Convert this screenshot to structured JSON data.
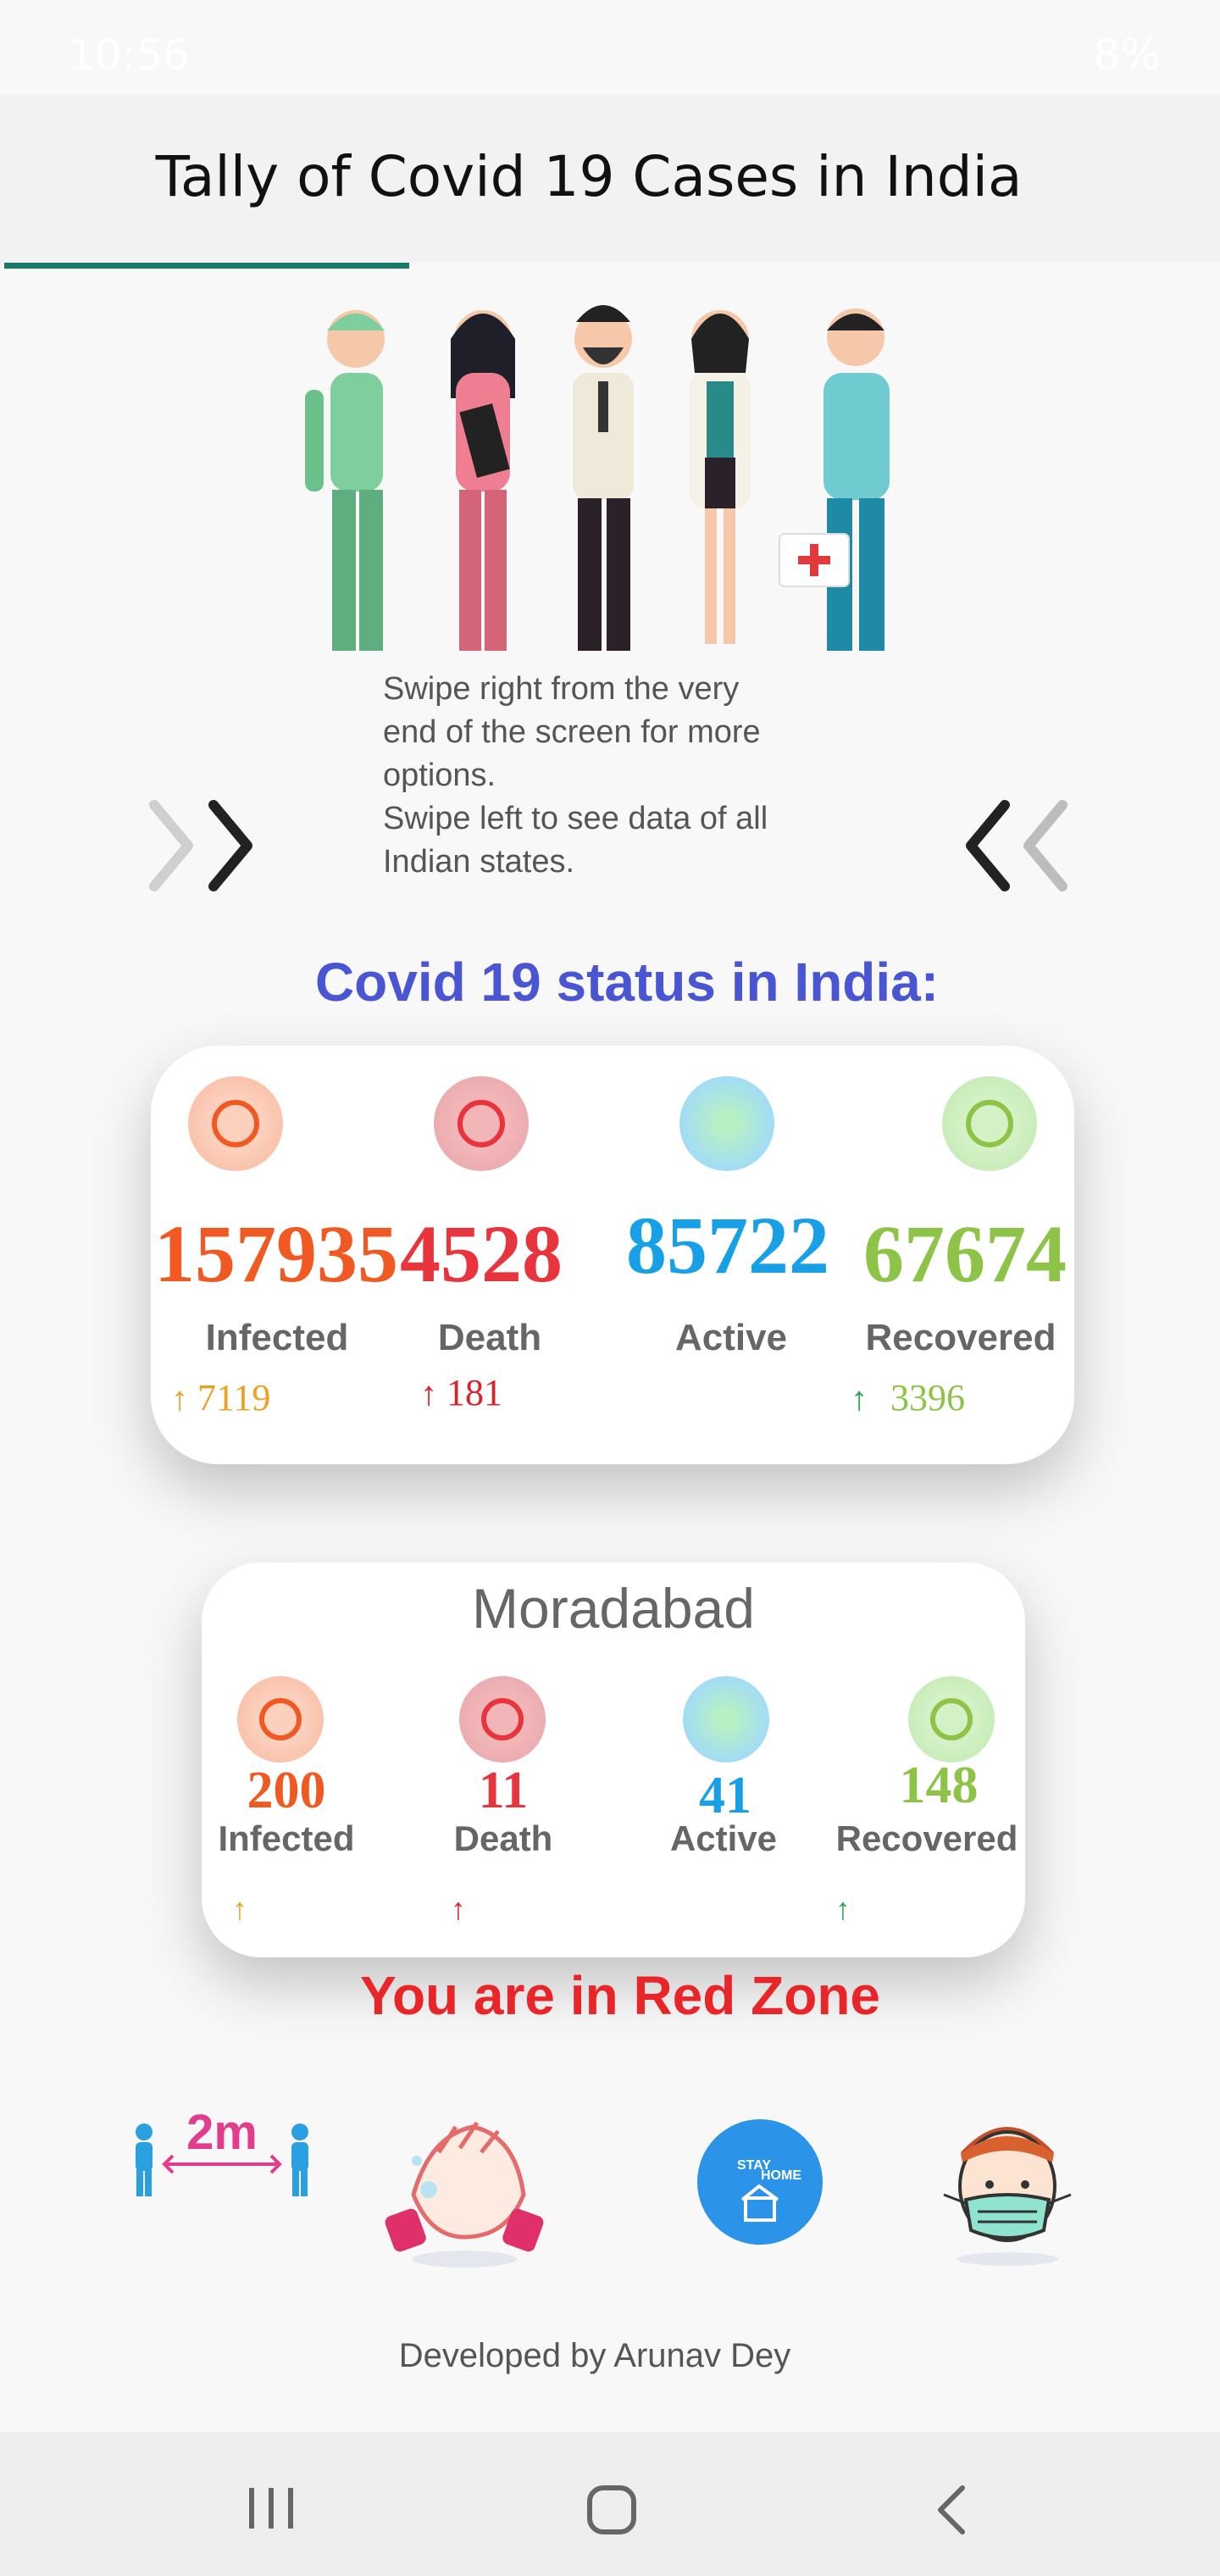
{
  "status_bar": {
    "time": "10:56",
    "battery": "8%"
  },
  "app_bar": {
    "title": "Tally of Covid 19 Cases in India"
  },
  "swipe_hint": {
    "text": "Swipe right from the very\nend of the screen for more\noptions.\nSwipe left to see data of all\nIndian states."
  },
  "india": {
    "heading": "Covid 19 status in India:",
    "stats": [
      {
        "label": "Infected",
        "value": "157935",
        "delta": "7119"
      },
      {
        "label": "Death",
        "value": "4528",
        "delta": "181"
      },
      {
        "label": "Active",
        "value": "85722",
        "delta": ""
      },
      {
        "label": "Recovered",
        "value": "67674",
        "delta": "3396"
      }
    ]
  },
  "city": {
    "name": "Moradabad",
    "stats": [
      {
        "label": "Infected",
        "value": "200"
      },
      {
        "label": "Death",
        "value": "11"
      },
      {
        "label": "Active",
        "value": "41"
      },
      {
        "label": "Recovered",
        "value": "148"
      }
    ],
    "zone_text": "You are in Red Zone"
  },
  "tips": {
    "distance_label": "2m",
    "stay_home_top": "STAY",
    "stay_home_bottom": "HOME"
  },
  "footer": {
    "text": "Developed by Arunav Dey"
  },
  "colors": {
    "infected": "#f05a22",
    "death": "#e8343c",
    "active": "#18a0e6",
    "recovered": "#8dc447",
    "delta_infected": "#f0a020",
    "delta_death": "#e01e2a",
    "delta_recovered": "#2aa84a",
    "heading": "#4a55d3",
    "zone": "#e8262a",
    "tab_indicator": "#1a7a6a"
  }
}
